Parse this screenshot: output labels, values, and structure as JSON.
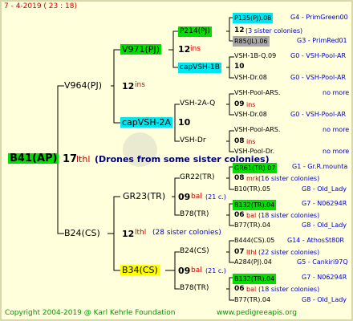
{
  "header": {
    "date": "7 -   4-2019  (  23 :  18)"
  },
  "footer": {
    "copyright": "Copyright 2004-2019 @ Karl Kehrle Foundation",
    "url": "www.pedigreeapis.org"
  },
  "root": {
    "name": "B41(AP)",
    "gen": "17",
    "code": "lthl",
    "note": "(Drones from some sister colonies)"
  },
  "father": {
    "name": "V964(PJ)",
    "gen": "12",
    "code": "ins"
  },
  "mother": {
    "name": "B24(CS)",
    "gen": "12",
    "code": "lthl",
    "note": "(28 sister colonies)"
  },
  "ff": {
    "name": "V971(PJ)",
    "gen": "12",
    "code": "ins"
  },
  "fm": {
    "name": "capVSH-2A",
    "gen": "10"
  },
  "mf": {
    "name": "GR23(TR)",
    "gen": "09",
    "code": "bal",
    "note": "(21 c.)"
  },
  "mm": {
    "name": "B34(CS)",
    "gen": "09",
    "code": "bal",
    "note": "(21 c.)"
  },
  "gen3": [
    {
      "name": "P214(PJ)"
    },
    {
      "name": "capVSH-1B"
    },
    {
      "name": "VSH-2A-Q"
    },
    {
      "name": "VSH-Dr"
    },
    {
      "name": "GR22(TR)"
    },
    {
      "name": "B78(TR)"
    },
    {
      "name": "B24(CS)"
    },
    {
      "name": "B78(TR)"
    }
  ],
  "gen3_mid": [
    {
      "gen": "12",
      "code": "ins"
    },
    {
      "gen": "10"
    },
    {
      "gen": "09",
      "code": "ins"
    },
    {
      "gen": "08",
      "code": "ins"
    },
    {
      "gen": "08",
      "code": "mrk",
      "note": "(16 sister colonies)"
    },
    {
      "gen": "06",
      "code": "bal",
      "note": "(18 sister colonies)"
    },
    {
      "gen": "07",
      "code": "lthl",
      "note": "(22 sister colonies)"
    },
    {
      "gen": "06",
      "code": "bal",
      "note": "(18 sister colonies)"
    }
  ],
  "gen4": [
    {
      "name": "P135(PJ).08",
      "ref": "G4 - PrimGreen00"
    },
    {
      "name": "R85(JL).06",
      "ref": "G3 - PrimRed01"
    },
    {
      "name": "VSH-1B-Q.09",
      "ref": "G0 - VSH-Pool-AR"
    },
    {
      "name": "VSH-Dr.08",
      "ref": "G0 - VSH-Pool-AR"
    },
    {
      "name": "VSH-Pool-ARS.",
      "ref": "no more"
    },
    {
      "name": "VSH-Dr.08",
      "ref": "G0 - VSH-Pool-AR"
    },
    {
      "name": "VSH-Pool-ARS.",
      "ref": "no more"
    },
    {
      "name": "VSH-Pool-Dr.",
      "ref": "no more"
    },
    {
      "name": "GR61(TR).07",
      "ref": "G1 - Gr.R.mounta"
    },
    {
      "name": "B10(TR).05",
      "ref": "G8 - Old_Lady"
    },
    {
      "name": "B132(TR).04",
      "ref": "G7 - N06294R"
    },
    {
      "name": "B77(TR).04",
      "ref": "G8 - Old_Lady"
    },
    {
      "name": "B444(CS).05",
      "ref": "G14 - AthosSt80R"
    },
    {
      "name": "A284(PJ).04",
      "ref": "G5 - Cankiri97Q"
    },
    {
      "name": "B132(TR).04",
      "ref": "G7 - N06294R"
    },
    {
      "name": "B77(TR).04",
      "ref": "G8 - Old_Lady"
    }
  ]
}
